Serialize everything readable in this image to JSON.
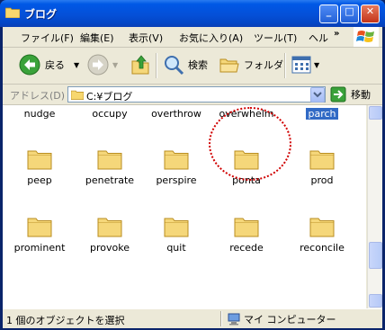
{
  "window": {
    "title": "ブログ",
    "icon": "folder-icon"
  },
  "title_buttons": [
    {
      "name": "minimize",
      "glyph": "_"
    },
    {
      "name": "maximize",
      "glyph": "□"
    },
    {
      "name": "close",
      "glyph": "✕"
    }
  ],
  "menu": {
    "items": [
      "ファイル(F)",
      "編集(E)",
      "表示(V)",
      "お気に入り(A)",
      "ツール(T)",
      "ヘル"
    ],
    "overflow": "»"
  },
  "toolbar": {
    "back_label": "戻る",
    "search_label": "検索",
    "folders_label": "フォルダ"
  },
  "address": {
    "label": "アドレス(D)",
    "value": "C:¥ブログ",
    "go_label": "移動"
  },
  "files": [
    {
      "label": "nudge",
      "selected": false
    },
    {
      "label": "occupy",
      "selected": false
    },
    {
      "label": "overthrow",
      "selected": false
    },
    {
      "label": "overwhelm",
      "selected": false
    },
    {
      "label": "parch",
      "selected": true
    },
    {
      "label": "peep",
      "selected": false
    },
    {
      "label": "penetrate",
      "selected": false
    },
    {
      "label": "perspire",
      "selected": false
    },
    {
      "label": "ponta",
      "selected": false
    },
    {
      "label": "prod",
      "selected": false
    },
    {
      "label": "prominent",
      "selected": false
    },
    {
      "label": "provoke",
      "selected": false
    },
    {
      "label": "quit",
      "selected": false
    },
    {
      "label": "recede",
      "selected": false
    },
    {
      "label": "reconcile",
      "selected": false
    }
  ],
  "status": {
    "left": "1 個のオブジェクトを選択",
    "right": "マイ コンピューター"
  },
  "colors": {
    "title": "#0058e6",
    "selection": "#316ac5",
    "folder": "#f5d77a",
    "annotation": "#d00000"
  }
}
